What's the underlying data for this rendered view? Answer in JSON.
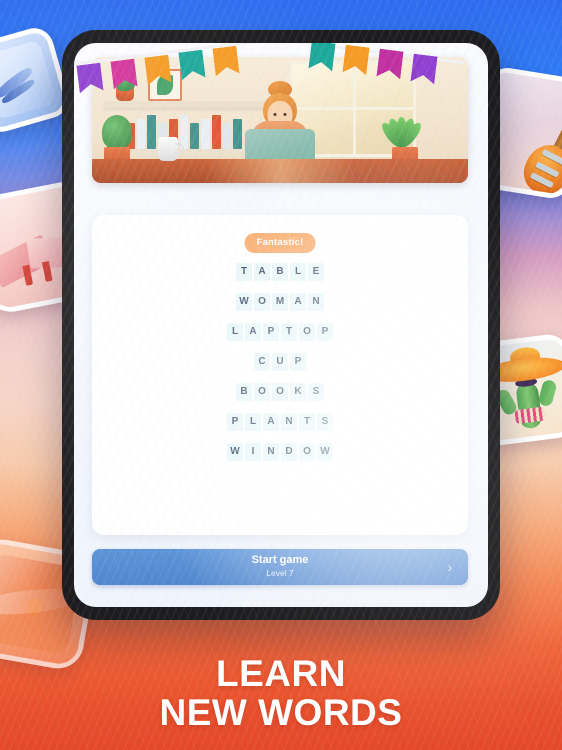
{
  "app": {
    "headline_line1": "LEARN",
    "headline_line2": "NEW WORDS"
  },
  "screen": {
    "badge": "Fantastic!",
    "words": [
      {
        "text": "TABLE",
        "letters": [
          "T",
          "A",
          "B",
          "L",
          "E"
        ]
      },
      {
        "text": "WOMAN",
        "letters": [
          "W",
          "O",
          "M",
          "A",
          "N"
        ]
      },
      {
        "text": "LAPTOP",
        "letters": [
          "L",
          "A",
          "P",
          "T",
          "O",
          "P"
        ]
      },
      {
        "text": "CUP",
        "letters": [
          "C",
          "U",
          "P"
        ]
      },
      {
        "text": "BOOKS",
        "letters": [
          "B",
          "O",
          "O",
          "K",
          "S"
        ]
      },
      {
        "text": "PLANTS",
        "letters": [
          "P",
          "L",
          "A",
          "N",
          "T",
          "S"
        ]
      },
      {
        "text": "WINDOW",
        "letters": [
          "W",
          "I",
          "N",
          "D",
          "O",
          "W"
        ]
      }
    ],
    "start_button": {
      "label": "Start game",
      "sublabel": "Level 7",
      "chevron": "›"
    },
    "hero_alt": "woman-at-desk-with-laptop-illustration",
    "bunting_colors_left": [
      "#8f3fd0",
      "#d4339a",
      "#f59a22",
      "#1aa79a",
      "#f59a22"
    ],
    "bunting_colors_right": [
      "#1aa79a",
      "#f59a22",
      "#c02ea0",
      "#8f3fd0"
    ]
  },
  "stickers": [
    {
      "name": "blue-card-sticker"
    },
    {
      "name": "open-book-sticker"
    },
    {
      "name": "guitar-sticker"
    },
    {
      "name": "cactus-sombrero-sticker"
    },
    {
      "name": "hand-sticker"
    }
  ],
  "colors": {
    "badge": "#f8a35c",
    "tile_bg": "#e4f6f8",
    "tile_text": "#18324e",
    "button": "#4f86cf",
    "bezel": "#1c1c1e",
    "headline": "#ffffff"
  }
}
